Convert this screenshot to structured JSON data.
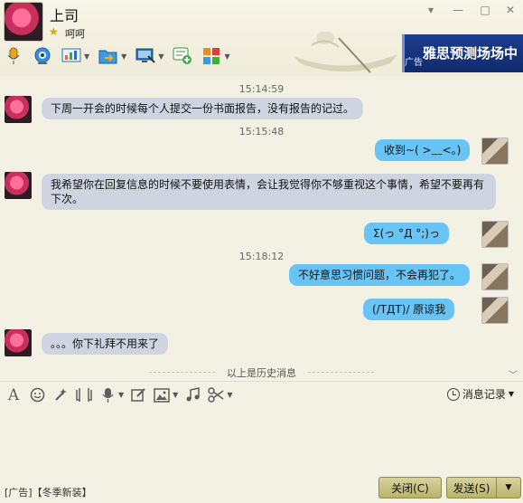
{
  "contact": {
    "name": "上司",
    "status": "呵呵"
  },
  "window": {
    "minimize": "▾",
    "minimize2": "—",
    "maximize": "□",
    "close": "✕"
  },
  "ad_banner": {
    "title": "雅思预测场场中",
    "small": "广告"
  },
  "toolbar": {
    "items": [
      {
        "icon": "microphone-icon"
      },
      {
        "icon": "webcam-icon"
      },
      {
        "icon": "whiteboard-icon"
      },
      {
        "icon": "send-file-icon"
      },
      {
        "icon": "remote-screen-icon"
      },
      {
        "icon": "add-app-icon"
      },
      {
        "icon": "apps-grid-icon"
      }
    ]
  },
  "messages": [
    {
      "type": "time",
      "text": "15:14:59"
    },
    {
      "type": "msg",
      "side": "left",
      "text": "下周一开会的时候每个人提交一份书面报告，没有报告的记过。"
    },
    {
      "type": "time",
      "text": "15:15:48"
    },
    {
      "type": "msg",
      "side": "right",
      "text": "收到~( >﹏<。)"
    },
    {
      "type": "msg",
      "side": "left",
      "text": "我希望你在回复信息的时候不要使用表情，会让我觉得你不够重视这个事情，希望不要再有下次。"
    },
    {
      "type": "msg",
      "side": "right",
      "text": "Σ(っ °Д °;)っ"
    },
    {
      "type": "time",
      "text": "15:18:12"
    },
    {
      "type": "msg",
      "side": "right",
      "text": "不好意思习惯问题，不会再犯了。"
    },
    {
      "type": "msg",
      "side": "right",
      "text": "(/TДT)/ 原谅我"
    },
    {
      "type": "msg",
      "side": "left",
      "text": "。。。你下礼拜不用来了"
    }
  ],
  "history_divider": "以上是历史消息",
  "input_toolbar": {
    "tools": [
      {
        "icon": "font-icon"
      },
      {
        "icon": "emoji-icon"
      },
      {
        "icon": "magic-wand-icon"
      },
      {
        "icon": "screenshot-icon"
      },
      {
        "icon": "voice-message-icon"
      },
      {
        "icon": "edit-icon"
      },
      {
        "icon": "image-icon"
      },
      {
        "icon": "music-icon"
      },
      {
        "icon": "scissors-icon"
      }
    ],
    "history_label": "消息记录"
  },
  "footer": {
    "ad_text": "[广告]【冬季新装】",
    "close_label": "关闭(C)",
    "send_label": "发送(S)"
  },
  "colors": {
    "bubble_left": "#cfd4e0",
    "bubble_right": "#69c4f6",
    "button": "#c8c284"
  }
}
